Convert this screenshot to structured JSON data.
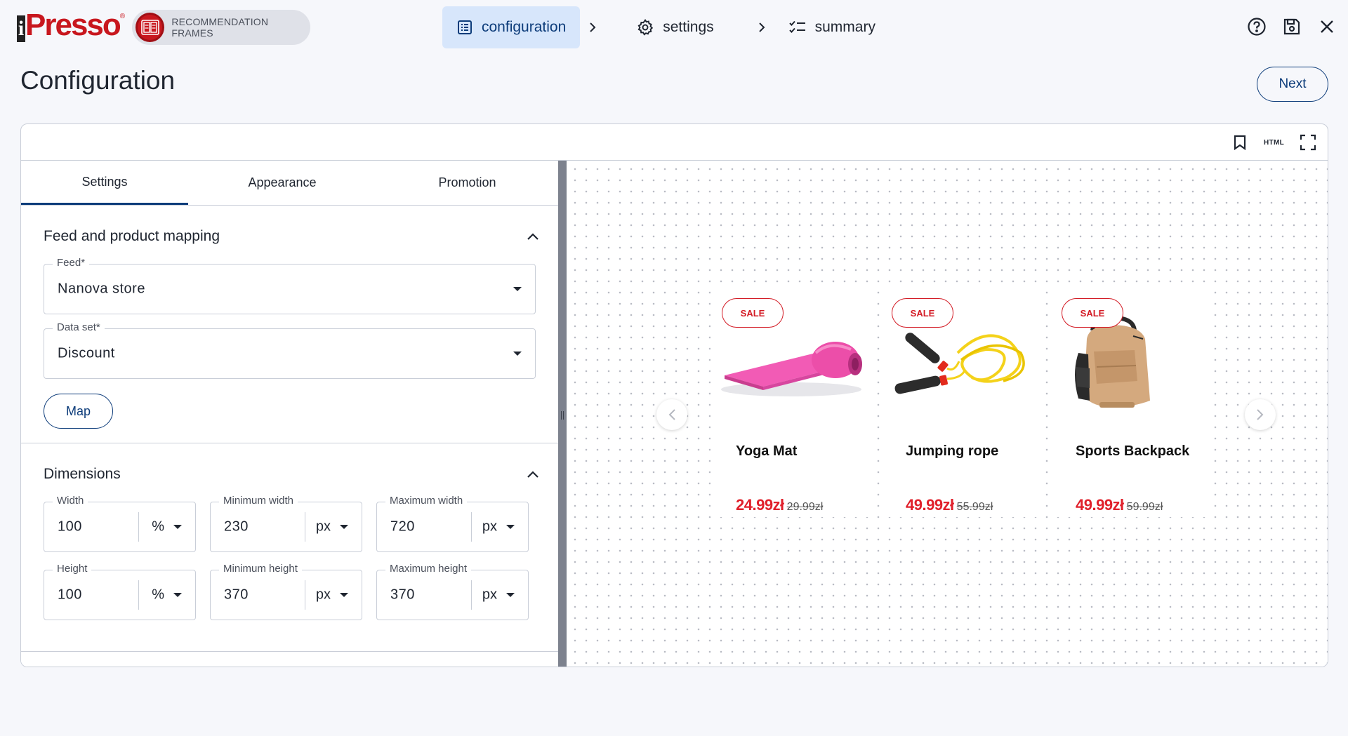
{
  "brand": {
    "logo_text": "iPresso",
    "module_label": "RECOMMENDATION FRAMES"
  },
  "steps": [
    {
      "label": "configuration",
      "icon": "list-box-icon",
      "active": true
    },
    {
      "label": "settings",
      "icon": "gear-icon",
      "active": false
    },
    {
      "label": "summary",
      "icon": "checklist-icon",
      "active": false
    }
  ],
  "top_actions": [
    "help-icon",
    "save-icon",
    "close-icon"
  ],
  "page": {
    "title": "Configuration",
    "next_label": "Next"
  },
  "card_toolbar": {
    "bookmark_icon": "bookmark-icon",
    "html_label": "HTML",
    "fullscreen_icon": "fullscreen-icon"
  },
  "tabs": [
    {
      "label": "Settings",
      "active": true
    },
    {
      "label": "Appearance",
      "active": false
    },
    {
      "label": "Promotion",
      "active": false
    }
  ],
  "feed_section": {
    "title": "Feed and product mapping",
    "feed": {
      "label": "Feed",
      "required_mark": "*",
      "value": "Nanova store"
    },
    "dataset": {
      "label": "Data set",
      "required_mark": "*",
      "value": "Discount"
    },
    "map_label": "Map"
  },
  "dimensions": {
    "title": "Dimensions",
    "width": {
      "label": "Width",
      "value": "100",
      "unit": "%"
    },
    "min_width": {
      "label": "Minimum width",
      "value": "230",
      "unit": "px"
    },
    "max_width": {
      "label": "Maximum width",
      "value": "720",
      "unit": "px"
    },
    "height": {
      "label": "Height",
      "value": "100",
      "unit": "%"
    },
    "min_height": {
      "label": "Minimum height",
      "value": "370",
      "unit": "px"
    },
    "max_height": {
      "label": "Maximum height",
      "value": "370",
      "unit": "px"
    }
  },
  "products": [
    {
      "badge": "SALE",
      "name": "Yoga Mat",
      "price": "24.99zł",
      "old_price": "29.99zł",
      "image": "yoga-mat"
    },
    {
      "badge": "SALE",
      "name": "Jumping rope",
      "price": "49.99zł",
      "old_price": "55.99zł",
      "image": "jumping-rope"
    },
    {
      "badge": "SALE",
      "name": "Sports Backpack",
      "price": "49.99zł",
      "old_price": "59.99zł",
      "image": "backpack"
    }
  ],
  "colors": {
    "brand_red": "#c8171e",
    "primary_blue": "#0d3c7a",
    "active_step_bg": "#d7e6fb",
    "sale_red": "#e0202b"
  }
}
